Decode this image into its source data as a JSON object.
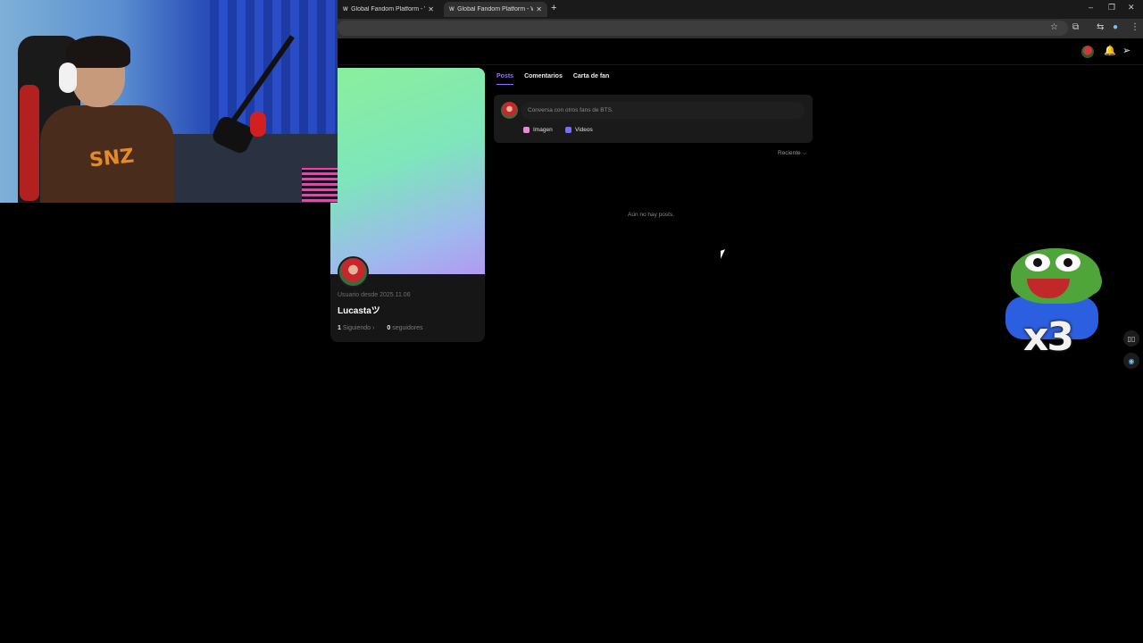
{
  "browser": {
    "tabs": [
      {
        "title": "Global Fandom Platform - We...",
        "favicon": "W",
        "active": false
      },
      {
        "title": "Global Fandom Platform - We...",
        "favicon": "W",
        "active": true
      }
    ],
    "new_tab_icon": "plus-icon",
    "window_controls": {
      "minimize": "–",
      "restore": "❐",
      "close": "✕"
    },
    "toolbar_icons": [
      "star-icon",
      "extensions-icon",
      "cast-icon",
      "profile-icon",
      "menu-icon"
    ]
  },
  "header": {
    "icons": [
      "avatar",
      "bell-icon",
      "send-icon"
    ],
    "bell_glyph": "🔔",
    "send_glyph": "➢"
  },
  "profile": {
    "member_since": "Usuario desde 2025.11.06",
    "username": "Lucastaツ",
    "following_count": "1",
    "following_label": "Siguiendo",
    "followers_count": "0",
    "followers_label": "seguidores",
    "cover_colors": [
      "#8cef9c",
      "#b19af0"
    ]
  },
  "content_tabs": [
    {
      "label": "Posts",
      "active": true
    },
    {
      "label": "Comentarios",
      "active": false
    },
    {
      "label": "Carta de fan",
      "active": false
    }
  ],
  "composer": {
    "placeholder": "Conversa con otros fans de BTS.",
    "image_label": "Imagen",
    "video_label": "Videos",
    "image_color": "#e88ad8",
    "video_color": "#7a6cff"
  },
  "sort": {
    "label": "Reciente",
    "chevron": "⌵"
  },
  "empty_state": "Aún no hay posts.",
  "emote": {
    "count_label": "x3"
  },
  "webcam": {
    "shirt_text": "SNZ"
  },
  "accent_color": "#9b6cff"
}
